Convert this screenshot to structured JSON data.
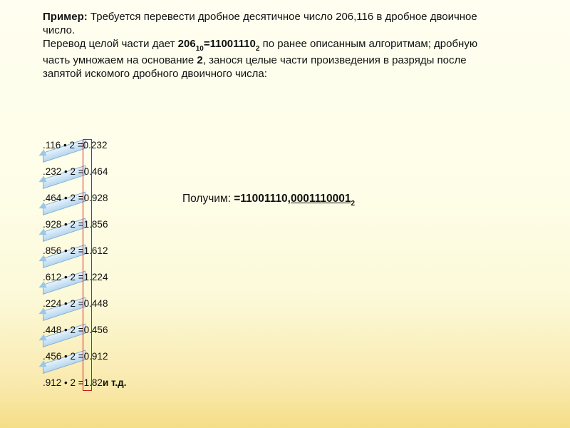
{
  "intro": {
    "example_label": "Пример:",
    "example_text": " Требуется перевести дробное десятичное число 206,116 в дробное двоичное число.",
    "line2a": "Перевод целой части дает ",
    "int_dec": "206",
    "int_dec_base": "10",
    "equals": "=",
    "int_bin": "11001110",
    "int_bin_base": "2",
    "line2b": " по ранее описанным алгоритмам; дробную часть умножаем на основание ",
    "base2": "2",
    "line2c": ", занося целые части произведения в разряды после запятой искомого дробного двоичного числа:"
  },
  "calc": [
    {
      "lhs": ".116 • 2 = ",
      "digit": "0",
      "frac": ".232",
      "tail": ""
    },
    {
      "lhs": ".232 • 2 = ",
      "digit": "0",
      "frac": ".464",
      "tail": ""
    },
    {
      "lhs": ".464 • 2 = ",
      "digit": "0",
      "frac": ".928",
      "tail": ""
    },
    {
      "lhs": ".928 • 2 = ",
      "digit": "1",
      "frac": ".856",
      "tail": ""
    },
    {
      "lhs": ".856 • 2 = ",
      "digit": "1",
      "frac": ".612",
      "tail": ""
    },
    {
      "lhs": ".612 • 2 = ",
      "digit": "1",
      "frac": ".224",
      "tail": ""
    },
    {
      "lhs": ".224 • 2 = ",
      "digit": "0",
      "frac": ".448",
      "tail": ""
    },
    {
      "lhs": ".448 • 2 = ",
      "digit": "0",
      "frac": ".456",
      "tail": ""
    },
    {
      "lhs": ".456 • 2 = ",
      "digit": "0",
      "frac": ".912",
      "tail": ""
    },
    {
      "lhs": ".912 • 2 = ",
      "digit": "1",
      "frac": ".82",
      "tail": "  и т.д."
    }
  ],
  "result": {
    "prefix": "Получим: ",
    "eq": "=",
    "int_part": "11001110,",
    "frac_part": "0001110001",
    "base": "2"
  }
}
